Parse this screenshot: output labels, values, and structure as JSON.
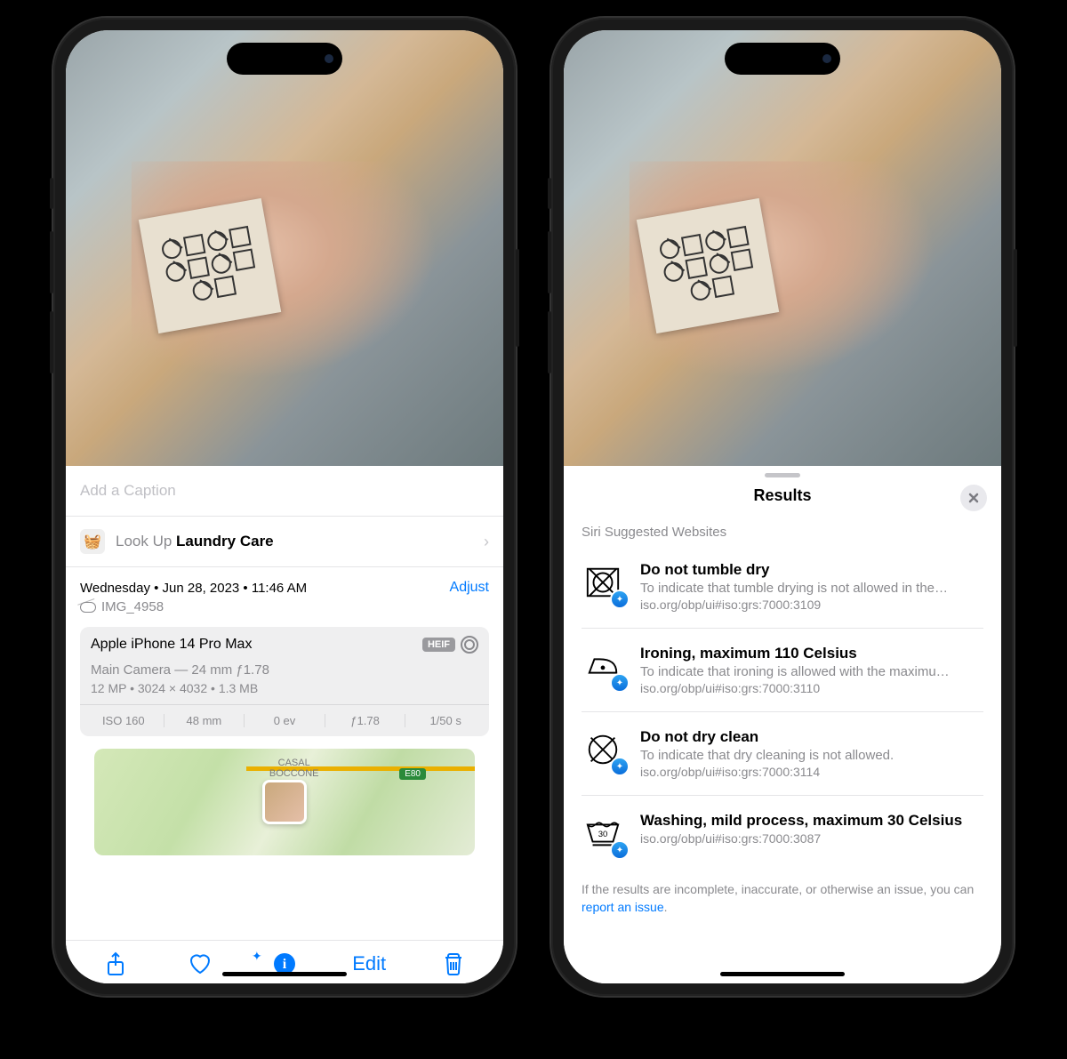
{
  "left": {
    "caption_placeholder": "Add a Caption",
    "lookup": {
      "prefix": "Look Up ",
      "topic": "Laundry Care"
    },
    "meta": {
      "date_line": "Wednesday • Jun 28, 2023 • 11:46 AM",
      "adjust_label": "Adjust",
      "filename": "IMG_4958",
      "device": "Apple iPhone 14 Pro Max",
      "format_badge": "HEIF",
      "lens_line": "Main Camera — 24 mm ƒ1.78",
      "specs_line": "12 MP  •  3024 × 4032  •  1.3 MB",
      "exif": {
        "iso": "ISO 160",
        "focal": "48 mm",
        "ev": "0 ev",
        "aperture": "ƒ1.78",
        "shutter": "1/50 s"
      }
    },
    "map": {
      "place": "CASAL\nBOCCONE",
      "road_badge": "E80"
    },
    "toolbar": {
      "edit": "Edit"
    }
  },
  "right": {
    "sheet_title": "Results",
    "section_label": "Siri Suggested Websites",
    "results": [
      {
        "title": "Do not tumble dry",
        "desc": "To indicate that tumble drying is not allowed in the…",
        "url": "iso.org/obp/ui#iso:grs:7000:3109"
      },
      {
        "title": "Ironing, maximum 110 Celsius",
        "desc": "To indicate that ironing is allowed with the maximu…",
        "url": "iso.org/obp/ui#iso:grs:7000:3110"
      },
      {
        "title": "Do not dry clean",
        "desc": "To indicate that dry cleaning is not allowed.",
        "url": "iso.org/obp/ui#iso:grs:7000:3114"
      },
      {
        "title": "Washing, mild process, maximum 30 Celsius",
        "desc": "",
        "url": "iso.org/obp/ui#iso:grs:7000:3087"
      }
    ],
    "footer": {
      "text_before": "If the results are incomplete, inaccurate, or otherwise an issue, you can ",
      "link": "report an issue",
      "text_after": "."
    }
  }
}
